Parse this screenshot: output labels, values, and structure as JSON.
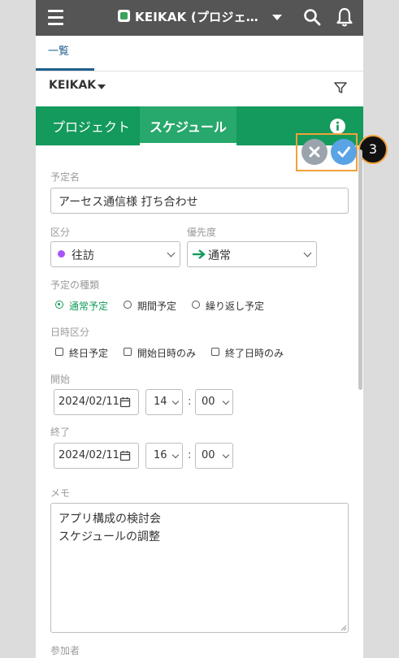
{
  "app": {
    "title": "KEIKAK (プロジェ…"
  },
  "nav": {
    "tab_list": "一覧",
    "project": "KEIKAK"
  },
  "green_tabs": {
    "project": "プロジェクト",
    "schedule": "スケジュール"
  },
  "step_badge": "3",
  "form": {
    "title_label": "予定名",
    "title_value": "アーセス通信様 打ち合わせ",
    "category_label": "区分",
    "category_value": "往訪",
    "category_color": "#a855f7",
    "priority_label": "優先度",
    "priority_value": "通常",
    "priority_color": "#139a5c",
    "type_label": "予定の種類",
    "type_options": [
      "通常予定",
      "期間予定",
      "繰り返し予定"
    ],
    "type_selected": "通常予定",
    "time_label": "日時区分",
    "time_options": [
      "終日予定",
      "開始日時のみ",
      "終了日時のみ"
    ],
    "start_label": "開始",
    "start_date": "2024/02/11",
    "start_hour": "14",
    "start_minute": "00",
    "end_label": "終了",
    "end_date": "2024/02/11",
    "end_hour": "16",
    "end_minute": "00",
    "time_separator": ":",
    "memo_label": "メモ",
    "memo_line1": "アプリ構成の検討会",
    "memo_line2": "スケジュールの調整",
    "participants_label": "参加者"
  },
  "colors": {
    "app_bar": "#555555",
    "green": "#139a5c",
    "accent_blue": "#5aa4e6",
    "callout": "#f2a13a"
  }
}
